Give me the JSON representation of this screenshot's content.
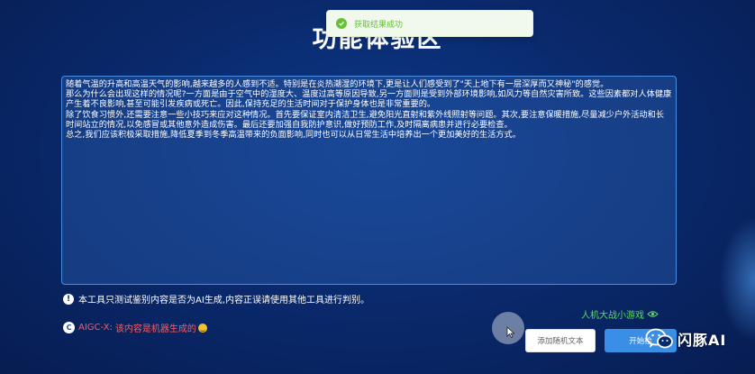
{
  "page": {
    "title": "功能体验区"
  },
  "toast": {
    "message": "获取结果成功",
    "color": "#67c23a"
  },
  "text_panel": {
    "content": "随着气温的升高和高温天气的影响,越来越多的人感到不适。特别是在炎热潮湿的环境下,更是让人们感受到了\"天上地下有一层深厚而又神秘\"的感觉。\n那么为什么会出现这样的情况呢?一方面是由于空气中的湿度大、温度过高等原因导致,另一方面则是受到外部环境影响,如风力等自然灾害所致。这些因素都对人体健康产生着不良影响,甚至可能引发疾病或死亡。因此,保持充足的生活时间对于保护身体也是非常重要的。\n除了饮食习惯外,还需要注意一些小技巧来应对这种情况。首先要保证室内清洁卫生,避免阳光直射和紫外线照射等问题。其次,要注意保暖措施,尽量减少户外活动和长时间站立的情况,以免感冒或其他意外造成伤害。最后还要加强自我防护意识,做好预防工作,及时隔离病患并进行必要检查。\n总之,我们应该积极采取措施,降低夏季到冬季高温带来的负面影响,同时也可以从日常生活中培养出一个更加美好的生活方式。"
  },
  "disclaimer": {
    "text": "本工具只测试鉴别内容是否为AI生成,内容正误请使用其他工具进行判别。"
  },
  "result": {
    "prefix": "AIGC-X:",
    "text": "该内容是机器生成的",
    "color": "#ff5b5b"
  },
  "game_link": {
    "label": "人机大战小游戏",
    "color": "#5ddc5d"
  },
  "buttons": {
    "add_random": "添加随机文本",
    "start": "开始检"
  },
  "watermark": {
    "text": "闪豚AI"
  },
  "colors": {
    "background": "#0a2a6e",
    "panel_border": "#4b8ee0",
    "primary_button": "#3a8ee6"
  }
}
